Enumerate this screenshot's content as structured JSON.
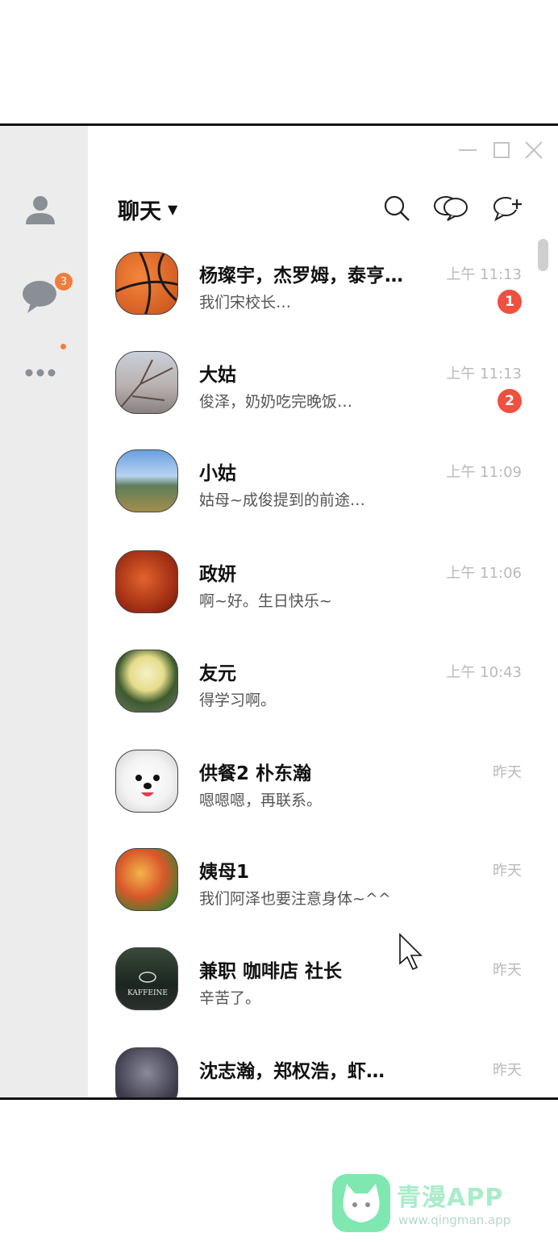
{
  "header": {
    "title": "聊天",
    "icons": [
      "search-icon",
      "open-chat-icon",
      "new-chat-icon"
    ]
  },
  "sidebar": {
    "items": [
      {
        "name": "friends",
        "icon": "person-icon"
      },
      {
        "name": "chats",
        "icon": "chat-bubble-icon",
        "badge": "3"
      },
      {
        "name": "more",
        "icon": "more-icon"
      }
    ],
    "accent": "#f07d3a"
  },
  "chats": [
    {
      "name": "杨璨宇，杰罗姆，泰亨…",
      "preview": "我们宋校长…",
      "time": "上午 11:13",
      "unread": "1",
      "avatar": "basketball"
    },
    {
      "name": "大姑",
      "preview": "俊泽，奶奶吃完晚饭…",
      "time": "上午 11:13",
      "unread": "2",
      "avatar": "cherry-blossom"
    },
    {
      "name": "小姑",
      "preview": "姑母~成俊提到的前途…",
      "time": "上午 11:09",
      "avatar": "landscape"
    },
    {
      "name": "政妍",
      "preview": "啊~好。生日快乐~",
      "time": "上午 11:06",
      "avatar": "fried-chicken"
    },
    {
      "name": "友元",
      "preview": "得学习啊。",
      "time": "上午 10:43",
      "avatar": "popcorn"
    },
    {
      "name": "供餐2 朴东瀚",
      "preview": "嗯嗯嗯，再联系。",
      "time": "昨天",
      "avatar": "puppy"
    },
    {
      "name": "姨母1",
      "preview": "我们阿泽也要注意身体~^^",
      "time": "昨天",
      "avatar": "pizza"
    },
    {
      "name": "兼职 咖啡店 社长",
      "preview": "辛苦了。",
      "time": "昨天",
      "avatar": "cafe-sign",
      "avatar_text": "KAFFEINE"
    },
    {
      "name": "沈志瀚，郑权浩，虾…",
      "preview": "",
      "time": "昨天",
      "avatar": "dark-photo"
    }
  ],
  "colors": {
    "badge": "#f0503f",
    "sidebar_bg": "#ececed",
    "time": "#b9b9b9"
  },
  "watermark": {
    "title": "青漫APP",
    "url": "www.qingman.app"
  }
}
